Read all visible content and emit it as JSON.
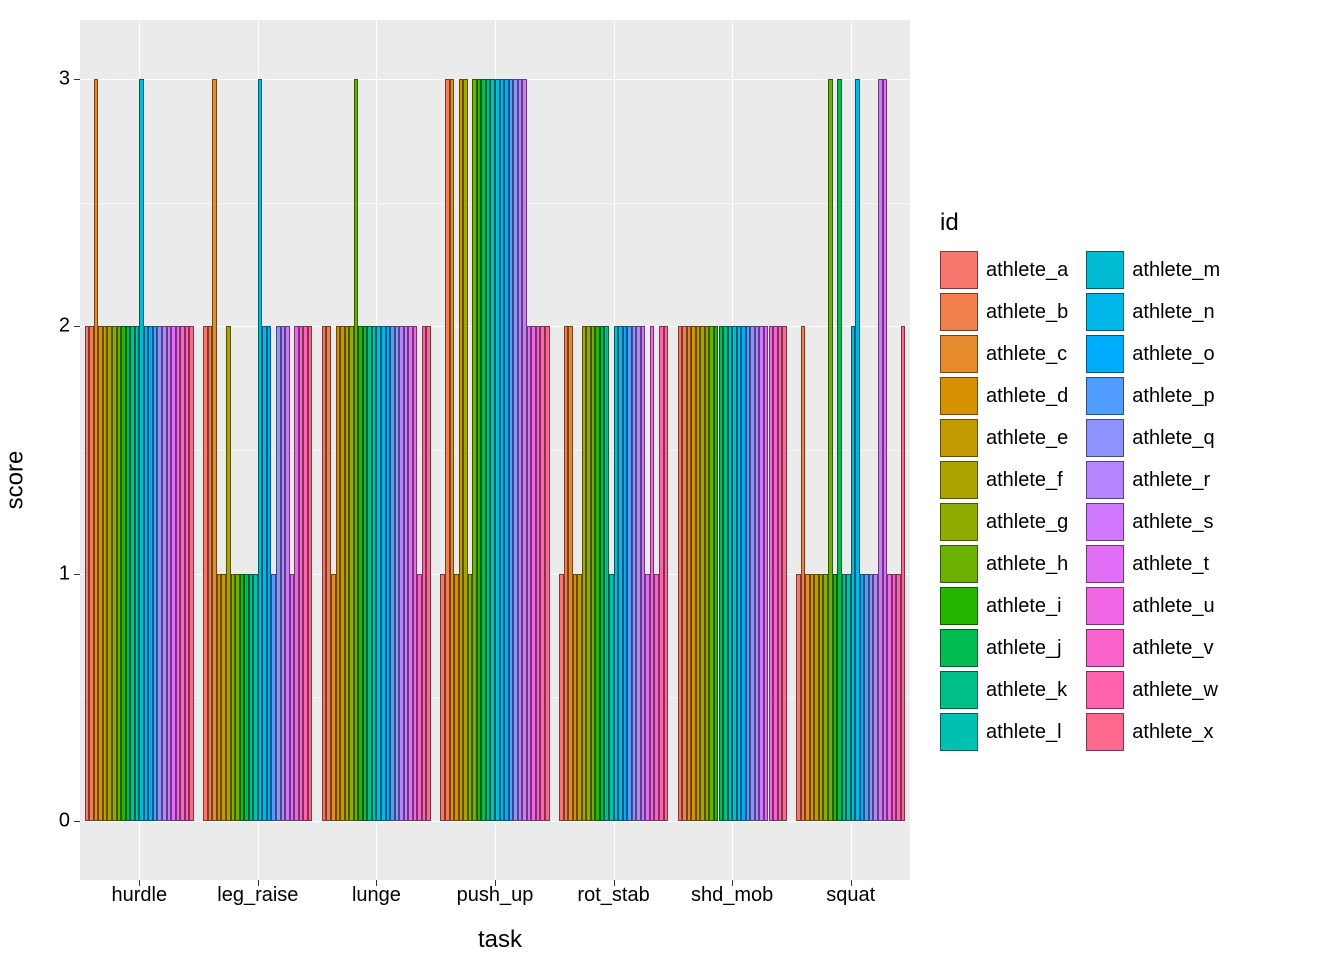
{
  "chart_data": {
    "type": "bar",
    "xlabel": "task",
    "ylabel": "score",
    "ylim": [
      0,
      3
    ],
    "y_ticks": [
      0,
      1,
      2,
      3
    ],
    "legend_title": "id",
    "categories": [
      "hurdle",
      "leg_raise",
      "lunge",
      "push_up",
      "rot_stab",
      "shd_mob",
      "squat"
    ],
    "series": [
      {
        "name": "athlete_a",
        "color": "#F8766D",
        "values": [
          2,
          2,
          2,
          1,
          1,
          2,
          1
        ]
      },
      {
        "name": "athlete_b",
        "color": "#F07F4D",
        "values": [
          2,
          2,
          2,
          3,
          2,
          2,
          2
        ]
      },
      {
        "name": "athlete_c",
        "color": "#E68A2E",
        "values": [
          3,
          3,
          1,
          3,
          2,
          2,
          1
        ]
      },
      {
        "name": "athlete_d",
        "color": "#D59100",
        "values": [
          2,
          1,
          2,
          1,
          1,
          2,
          1
        ]
      },
      {
        "name": "athlete_e",
        "color": "#C29B00",
        "values": [
          2,
          1,
          2,
          3,
          1,
          2,
          1
        ]
      },
      {
        "name": "athlete_f",
        "color": "#ABA300",
        "values": [
          2,
          2,
          2,
          3,
          2,
          2,
          1
        ]
      },
      {
        "name": "athlete_g",
        "color": "#8FAA00",
        "values": [
          2,
          1,
          2,
          1,
          2,
          2,
          1
        ]
      },
      {
        "name": "athlete_h",
        "color": "#6BB100",
        "values": [
          2,
          1,
          3,
          3,
          2,
          2,
          3
        ]
      },
      {
        "name": "athlete_i",
        "color": "#24B700",
        "values": [
          2,
          1,
          2,
          3,
          2,
          2,
          1
        ]
      },
      {
        "name": "athlete_j",
        "color": "#00BC51",
        "values": [
          2,
          1,
          2,
          3,
          2,
          2,
          3
        ]
      },
      {
        "name": "athlete_k",
        "color": "#00C087",
        "values": [
          2,
          1,
          2,
          3,
          2,
          2,
          1
        ]
      },
      {
        "name": "athlete_l",
        "color": "#00C0B2",
        "values": [
          2,
          1,
          2,
          3,
          1,
          2,
          1
        ]
      },
      {
        "name": "athlete_m",
        "color": "#00BDD4",
        "values": [
          3,
          3,
          2,
          3,
          2,
          2,
          2
        ]
      },
      {
        "name": "athlete_n",
        "color": "#00B7EC",
        "values": [
          2,
          2,
          2,
          3,
          2,
          2,
          3
        ]
      },
      {
        "name": "athlete_o",
        "color": "#00ACFC",
        "values": [
          2,
          2,
          2,
          3,
          2,
          2,
          1
        ]
      },
      {
        "name": "athlete_p",
        "color": "#509CFF",
        "values": [
          2,
          1,
          2,
          3,
          2,
          2,
          1
        ]
      },
      {
        "name": "athlete_q",
        "color": "#8E92FF",
        "values": [
          2,
          2,
          2,
          3,
          2,
          2,
          1
        ]
      },
      {
        "name": "athlete_r",
        "color": "#B385FF",
        "values": [
          2,
          2,
          2,
          3,
          2,
          2,
          1
        ]
      },
      {
        "name": "athlete_s",
        "color": "#CF78FF",
        "values": [
          2,
          2,
          2,
          3,
          2,
          2,
          3
        ]
      },
      {
        "name": "athlete_t",
        "color": "#E26EF7",
        "values": [
          2,
          1,
          2,
          2,
          1,
          2,
          3
        ]
      },
      {
        "name": "athlete_u",
        "color": "#F066E4",
        "values": [
          2,
          2,
          2,
          2,
          2,
          2,
          1
        ]
      },
      {
        "name": "athlete_v",
        "color": "#FA62CB",
        "values": [
          2,
          2,
          1,
          2,
          1,
          2,
          1
        ]
      },
      {
        "name": "athlete_w",
        "color": "#FF62AE",
        "values": [
          2,
          2,
          2,
          2,
          2,
          2,
          1
        ]
      },
      {
        "name": "athlete_x",
        "color": "#FF688E",
        "values": [
          2,
          2,
          2,
          2,
          2,
          2,
          2
        ]
      }
    ]
  }
}
